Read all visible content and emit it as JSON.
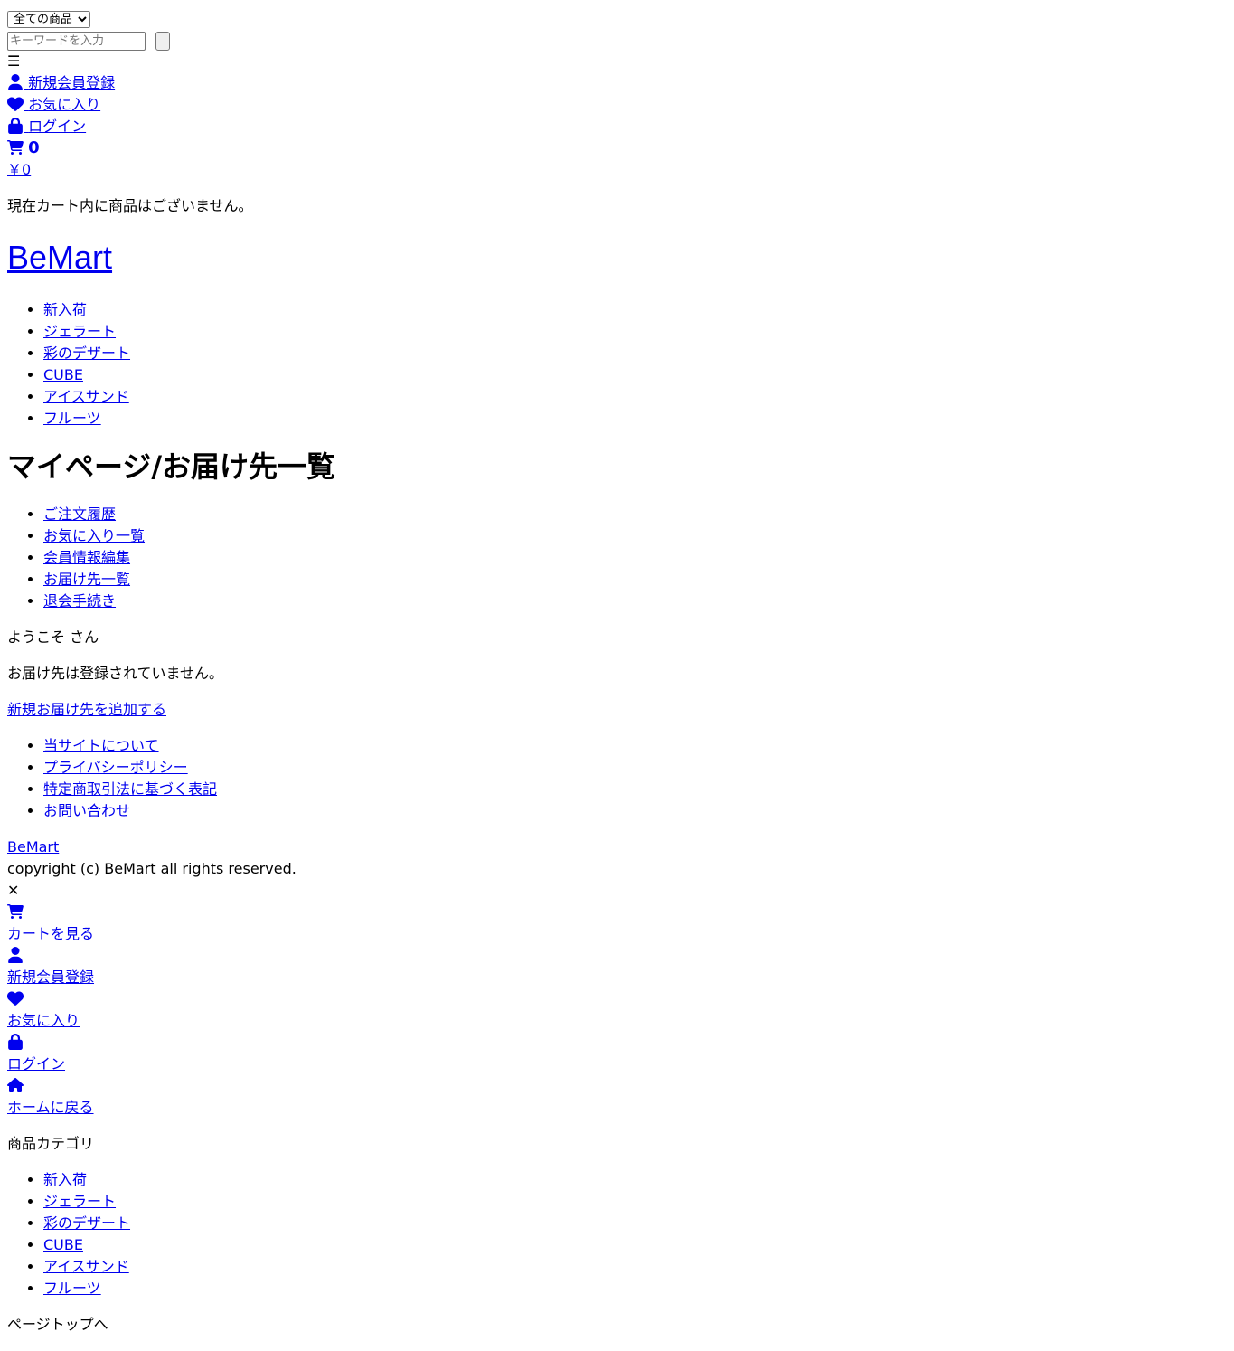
{
  "header": {
    "category_select": {
      "selected": "全ての商品"
    },
    "search": {
      "placeholder": "キーワードを入力",
      "value": ""
    },
    "menu_toggle": "☰",
    "member_links": {
      "register": "新規会員登録",
      "favorites": "お気に入り",
      "login": "ログイン"
    },
    "cart": {
      "count": "0",
      "total": "￥0",
      "empty_message": "現在カート内に商品はございません。"
    }
  },
  "site": {
    "logo": "BeMart"
  },
  "nav": {
    "categories": [
      "新入荷",
      "ジェラート",
      "彩のデザート",
      "CUBE",
      "アイスサンド",
      "フルーツ"
    ]
  },
  "main": {
    "title": "マイページ/お届け先一覧",
    "mypage_menu": [
      "ご注文履歴",
      "お気に入り一覧",
      "会員情報編集",
      "お届け先一覧",
      "退会手続き"
    ],
    "welcome": "ようこそ さん",
    "no_address_message": "お届け先は登録されていません。",
    "add_address_link": "新規お届け先を追加する"
  },
  "footer": {
    "links": [
      "当サイトについて",
      "プライバシーポリシー",
      "特定商取引法に基づく表記",
      "お問い合わせ"
    ],
    "logo": "BeMart",
    "copyright": "copyright (c) BeMart all rights reserved."
  },
  "drawer": {
    "close": "✕",
    "items": {
      "cart": "カートを見る",
      "register": "新規会員登録",
      "favorites": "お気に入り",
      "login": "ログイン",
      "home": "ホームに戻る"
    },
    "category_heading": "商品カテゴリ",
    "categories": [
      "新入荷",
      "ジェラート",
      "彩のデザート",
      "CUBE",
      "アイスサンド",
      "フルーツ"
    ]
  },
  "page_top": "ページトップへ",
  "colors": {
    "link": "#0000ee",
    "text": "#000000",
    "background": "#ffffff"
  },
  "icons": [
    "user-icon",
    "heart-icon",
    "lock-icon",
    "cart-icon",
    "home-icon",
    "close-icon",
    "menu-icon"
  ]
}
